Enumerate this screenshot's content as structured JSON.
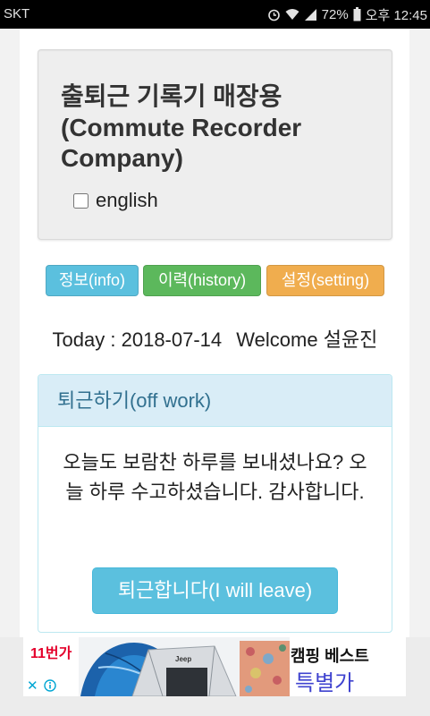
{
  "status_bar": {
    "carrier": "SKT",
    "battery_level": "72%",
    "time": "오후 12:45",
    "icons": [
      "alarm-icon",
      "wifi-icon",
      "signal-icon",
      "battery-icon"
    ]
  },
  "header": {
    "title_lines": [
      "출퇴근 기록기 매장용",
      "(Commute Recorder",
      "Company)"
    ],
    "english_label": "english",
    "english_checked": false
  },
  "nav": [
    {
      "label": "정보(info)",
      "color": "#5bc0de"
    },
    {
      "label": "이력(history)",
      "color": "#5cb85c"
    },
    {
      "label": "설정(setting)",
      "color": "#f0ad4e"
    }
  ],
  "greeting": {
    "today_label": "Today :",
    "date": "2018-07-14",
    "welcome_label": "Welcome",
    "user_name": "설윤진"
  },
  "panel": {
    "heading": "퇴근하기(off work)",
    "message": "오늘도 보람찬 하루를 보내셨나요? 오늘 하루 수고하셨습니다. 감사합니다.",
    "button_label": "퇴근합니다(I will leave)"
  },
  "ad": {
    "logo": "11번가",
    "headline": "캠핑 베스트",
    "subline": "특별가",
    "product_logo": "Jeep",
    "close_symbol": "✕",
    "icons": [
      "close-icon",
      "info-icon"
    ]
  },
  "colors": {
    "well_background": "#eeeeee",
    "panel_heading_background": "#d9edf7",
    "panel_heading_text": "#31708f",
    "leave_button": "#5bc0de",
    "ad_logo_red": "#e4002b",
    "ad_subline": "#3f43cf"
  }
}
